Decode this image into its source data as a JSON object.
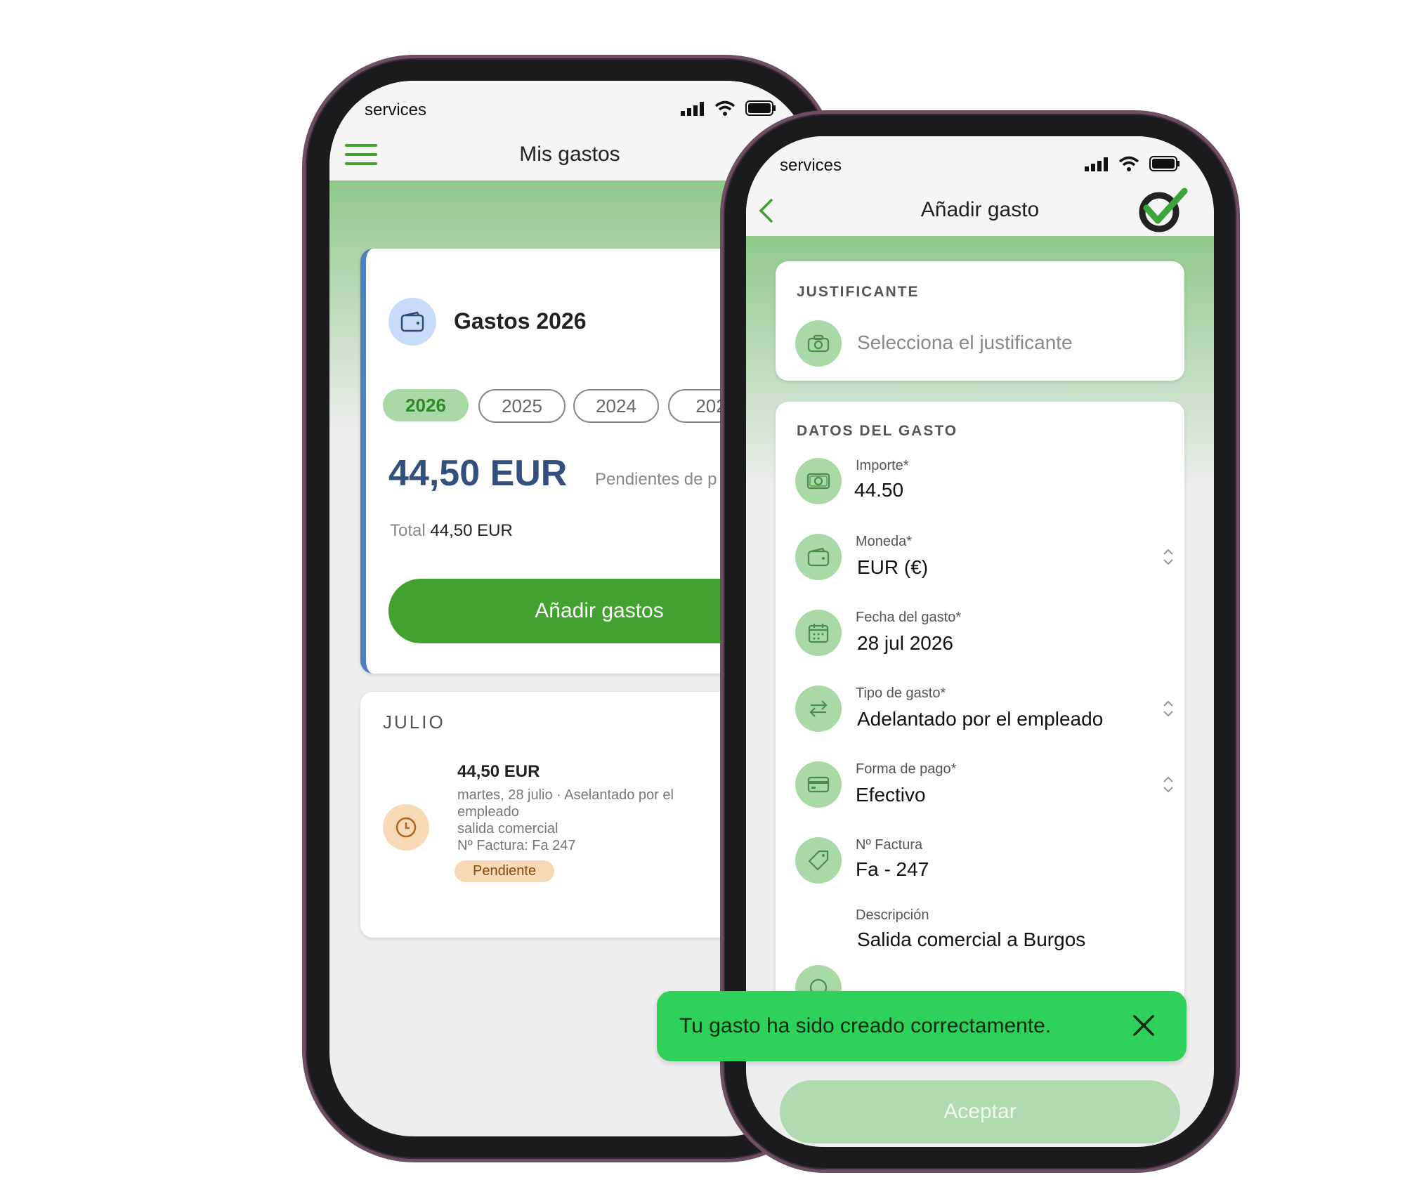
{
  "left_screen": {
    "carrier": "services",
    "title": "Mis gastos",
    "summary": {
      "heading": "Gastos 2026",
      "years": [
        "2026",
        "2025",
        "2024",
        "202"
      ],
      "amount": "44,50 EUR",
      "pending_label": "Pendientes de p",
      "total_label": "Total",
      "total_value": "44,50 EUR",
      "add_button": "Añadir gastos"
    },
    "month": {
      "label": "JULIO",
      "item": {
        "amount": "44,50 EUR",
        "line1": "martes, 28 julio · Aselantado por el",
        "line2": "empleado",
        "line3": "salida comercial",
        "line4": "Nº Factura: Fa 247",
        "status": "Pendiente"
      }
    }
  },
  "right_screen": {
    "carrier": "services",
    "title": "Añadir gasto",
    "justificante": {
      "heading": "JUSTIFICANTE",
      "placeholder": "Selecciona el justificante"
    },
    "datos": {
      "heading": "DATOS DEL GASTO",
      "fields": [
        {
          "label": "Importe*",
          "value": "44.50"
        },
        {
          "label": "Moneda*",
          "value": "EUR (€)"
        },
        {
          "label": "Fecha del gasto*",
          "value": "28 jul 2026"
        },
        {
          "label": "Tipo de gasto*",
          "value": "Adelantado por el empleado"
        },
        {
          "label": "Forma de pago*",
          "value": "Efectivo"
        },
        {
          "label": "Nº Factura",
          "value": "Fa - 247"
        },
        {
          "label": "Descripción",
          "value": "Salida comercial a Burgos"
        }
      ]
    },
    "accept_button": "Aceptar"
  },
  "toast": {
    "message": "Tu gasto ha sido creado correctamente."
  },
  "colors": {
    "primary_green": "#43a12f",
    "light_green": "#a8d9a6",
    "toast_green": "#2ed15a",
    "amount_blue": "#334f7e",
    "pending_orange": "#f7d9b6"
  }
}
